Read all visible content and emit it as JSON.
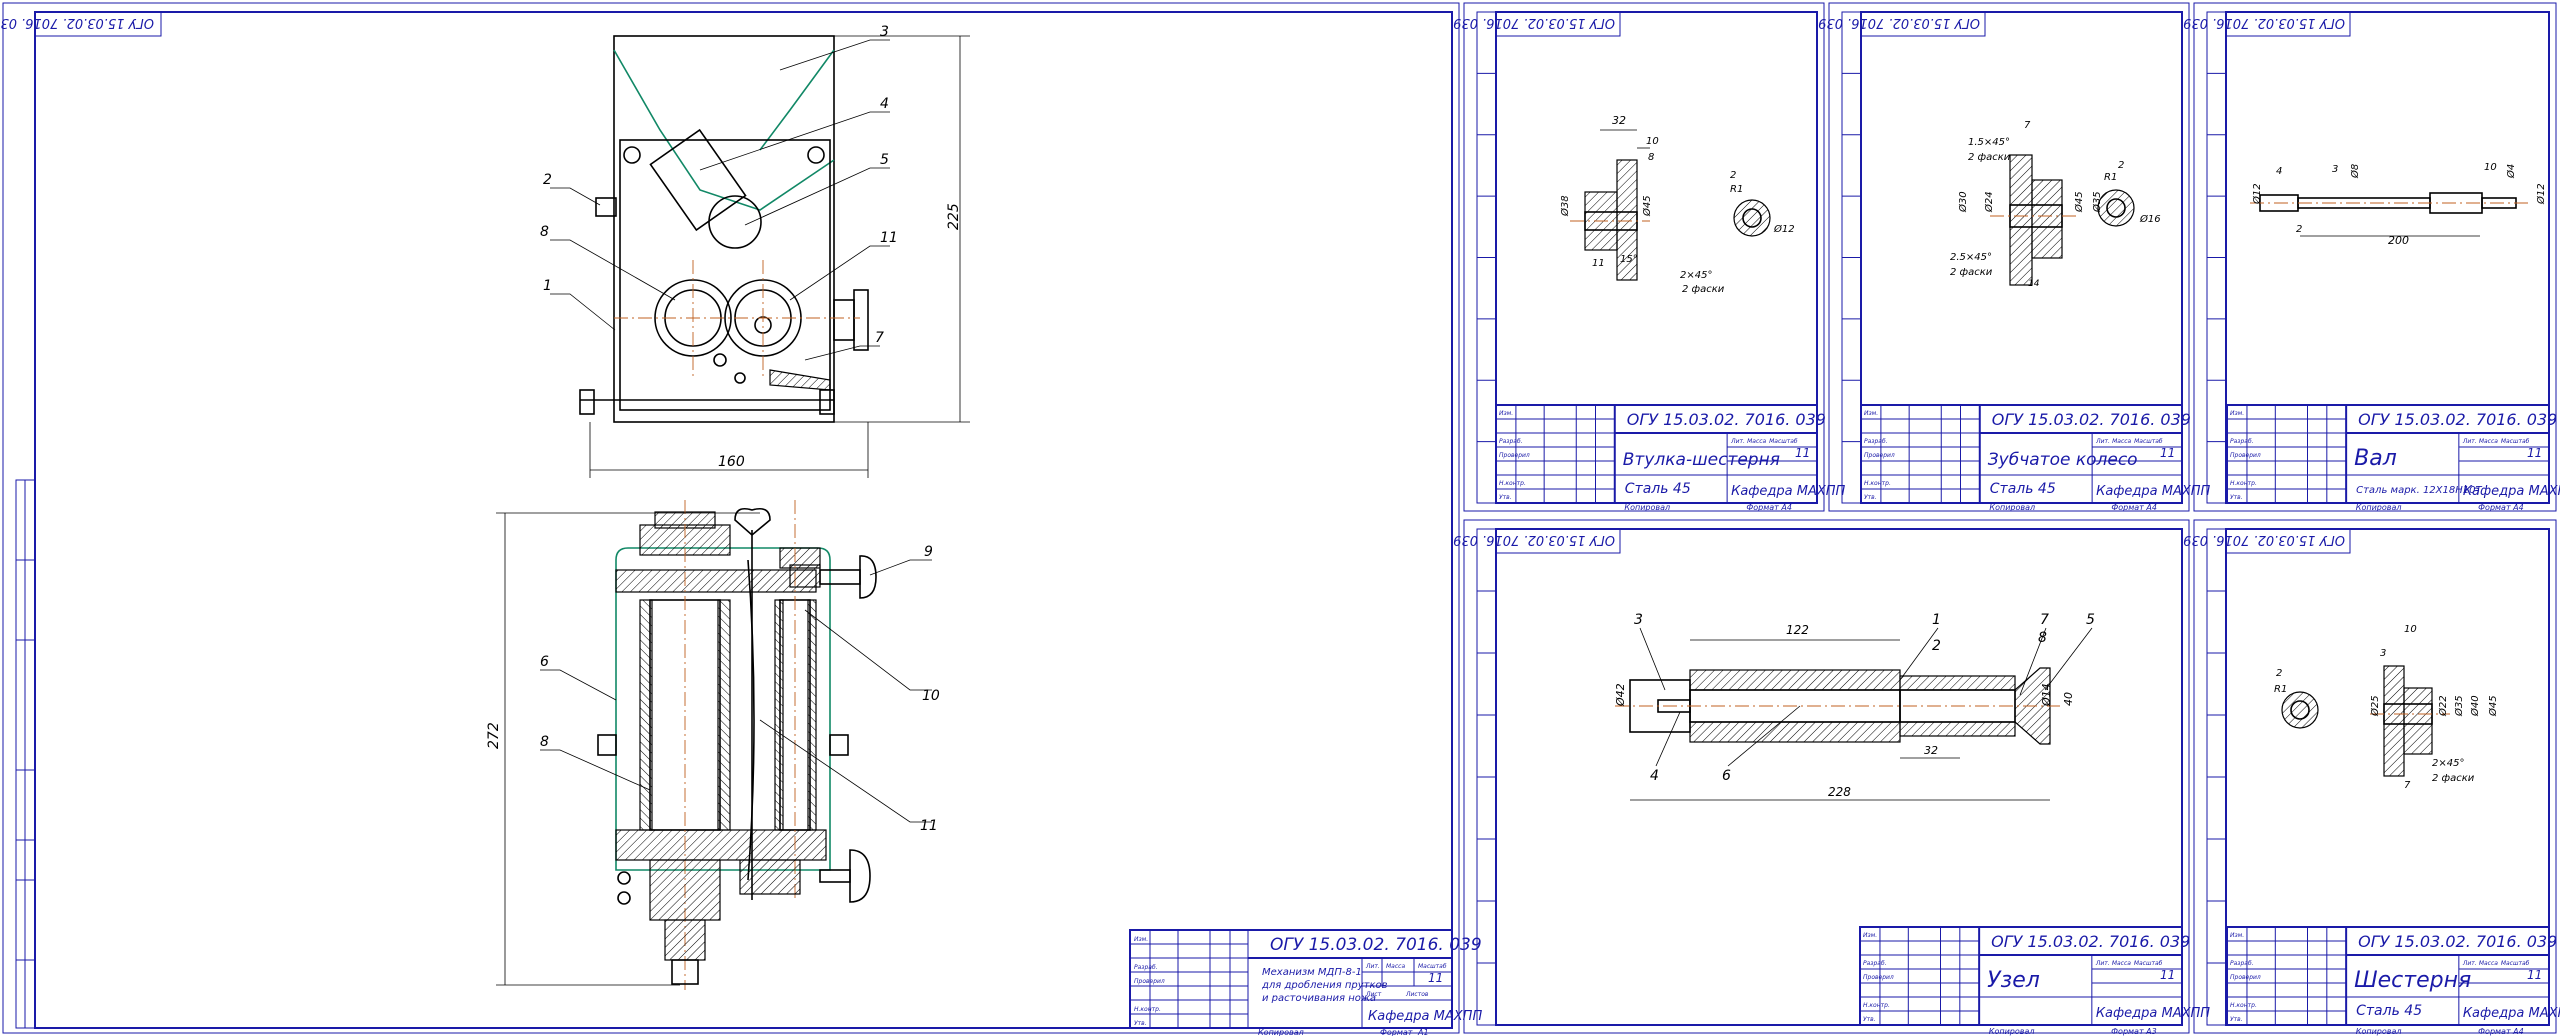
{
  "stamp_code": "ОГУ 15.03.02. 7016. 039",
  "top_stamp": "ОГУ 15.03.02. 7016. 039",
  "department": "Кафедра МАХПП",
  "copied_label": "Копировал",
  "format_label": "Формат",
  "sheet_count": "11",
  "main_assembly": {
    "title_lines": [
      "Механизм МДП-8-1",
      "для дробления прутков",
      "и расточивания ножа"
    ],
    "format": "А1",
    "labels": {
      "leader_top": [
        "3",
        "4",
        "5",
        "2",
        "8",
        "11",
        "1",
        "7"
      ],
      "leader_bottom": [
        "9",
        "6",
        "10",
        "8",
        "11"
      ]
    },
    "dims": {
      "height_top": "225",
      "width_top": "160",
      "height_bottom": "272"
    }
  },
  "sheets": [
    {
      "id": "vtulka",
      "title": "Втулка-шестерня",
      "material": "Сталь 45",
      "format": "А4",
      "dims": [
        "32",
        "10",
        "8",
        "Ø38",
        "Ø45",
        "11",
        "15°",
        "2×45°",
        "2 фаски",
        "2",
        "R1",
        "Ø12"
      ]
    },
    {
      "id": "koleso",
      "title": "Зубчатое колесо",
      "material": "Сталь 45",
      "format": "А4",
      "dims": [
        "7",
        "1.5×45°",
        "2 фаски",
        "Ø30",
        "Ø24",
        "Ø45",
        "Ø35",
        "2.5×45°",
        "2 фаски",
        "14",
        "R1",
        "2",
        "Ø16"
      ]
    },
    {
      "id": "val",
      "title": "Вал",
      "material": "Сталь марк. 12Х18Н10Т",
      "format": "А4",
      "dims": [
        "4",
        "3",
        "Ø8",
        "10",
        "Ø4",
        "Ø12",
        "Ø12",
        "2",
        "200"
      ]
    },
    {
      "id": "uzel",
      "title": "Узел",
      "material": "",
      "format": "А3",
      "labels": [
        "3",
        "1",
        "2",
        "7",
        "8",
        "5",
        "4",
        "6"
      ],
      "dims": [
        "122",
        "Ø42",
        "Ø14",
        "40",
        "32",
        "228"
      ]
    },
    {
      "id": "shesternya",
      "title": "Шестерня",
      "material": "Сталь 45",
      "format": "А4",
      "dims": [
        "10",
        "3",
        "2",
        "R1",
        "Ø25",
        "Ø22",
        "Ø35",
        "Ø40",
        "Ø45",
        "2×45°",
        "2 фаски",
        "7"
      ]
    }
  ],
  "tb_small": [
    "Изм.",
    "Лист",
    "№ докум.",
    "Подп.",
    "Дата",
    "Разраб.",
    "Проверил",
    "Т.контр.",
    "Н.контр.",
    "Утв.",
    "Лит.",
    "Масса",
    "Масштаб",
    "Лист",
    "Листов"
  ],
  "colors": {
    "frame": "#1a1aa8",
    "drawing": "#000000",
    "axis": "#c06020",
    "contour": "#118866"
  }
}
